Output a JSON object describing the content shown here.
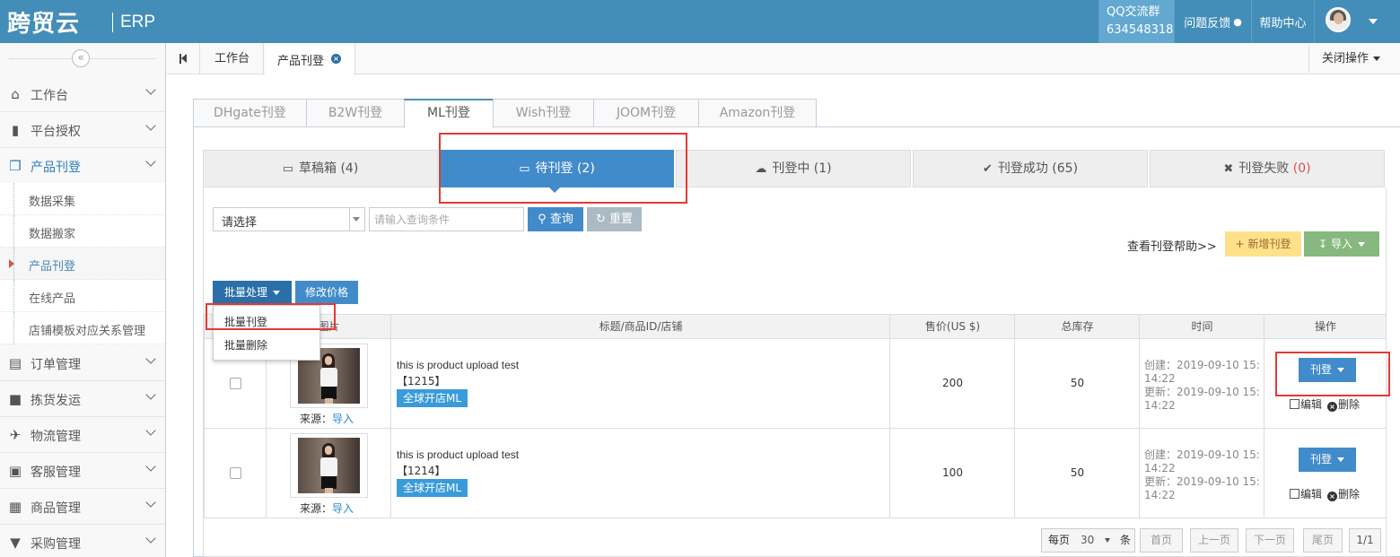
{
  "header": {
    "logo_text": "跨贸云",
    "logo_sub": "ERP",
    "qq_label": "QQ交流群",
    "qq_number": "634548318",
    "feedback": "问题反馈",
    "help": "帮助中心"
  },
  "sidebar": {
    "collapse": "«",
    "items": [
      {
        "label": "工作台",
        "icon": "home-icon"
      },
      {
        "label": "平台授权",
        "icon": "bookmark-icon"
      },
      {
        "label": "产品刊登",
        "icon": "cube-icon"
      },
      {
        "label": "订单管理",
        "icon": "document-icon"
      },
      {
        "label": "拣货发运",
        "icon": "truck-icon"
      },
      {
        "label": "物流管理",
        "icon": "plane-icon"
      },
      {
        "label": "客服管理",
        "icon": "briefcase-icon"
      },
      {
        "label": "商品管理",
        "icon": "gift-icon"
      },
      {
        "label": "采购管理",
        "icon": "cart-icon"
      }
    ],
    "subitems": [
      "数据采集",
      "数据搬家",
      "产品刊登",
      "在线产品",
      "店铺模板对应关系管理"
    ]
  },
  "tabs": {
    "work": "工作台",
    "current": "产品刊登",
    "close_ops": "关闭操作"
  },
  "platform_tabs": [
    "DHgate刊登",
    "B2W刊登",
    "ML刊登",
    "Wish刊登",
    "JOOM刊登",
    "Amazon刊登"
  ],
  "status_tabs": [
    {
      "label": "草稿箱",
      "count": "(4)"
    },
    {
      "label": "待刊登",
      "count": "(2)"
    },
    {
      "label": "刊登中",
      "count": "(1)"
    },
    {
      "label": "刊登成功",
      "count": "(65)"
    },
    {
      "label": "刊登失败",
      "count": "(0)"
    }
  ],
  "search": {
    "select_placeholder": "请选择",
    "input_placeholder": "请输入查询条件",
    "query": "查询",
    "reset": "重置"
  },
  "actions": {
    "help_link": "查看刊登帮助>>",
    "new": "新增刊登",
    "import": "导入",
    "batch": "批量处理",
    "modify_price": "修改价格",
    "batch_publish": "批量刊登",
    "batch_delete": "批量删除"
  },
  "table": {
    "headers": [
      "",
      "图片",
      "标题/商品ID/店铺",
      "售价(US $)",
      "总库存",
      "时间",
      "操作"
    ],
    "rows": [
      {
        "title": "this is product upload test",
        "id": "【1215】",
        "store": "全球开店ML",
        "source_label": "来源：",
        "source_value": "导入",
        "price": "200",
        "stock": "50",
        "created": "创建：2019-09-10 15:14:22",
        "updated": "更新：2019-09-10 15:14:22",
        "publish": "刊登",
        "edit": "编辑",
        "delete": "删除"
      },
      {
        "title": "this is product upload test",
        "id": "【1214】",
        "store": "全球开店ML",
        "source_label": "来源：",
        "source_value": "导入",
        "price": "100",
        "stock": "50",
        "created": "创建：2019-09-10 15:14:22",
        "updated": "更新：2019-09-10 15:14:22",
        "publish": "刊登",
        "edit": "编辑",
        "delete": "删除"
      }
    ]
  },
  "pager": {
    "per_page_label": "每页",
    "per_page": "30",
    "unit": "条",
    "first": "首页",
    "prev": "上一页",
    "next": "下一页",
    "last": "尾页",
    "page": "1/1"
  },
  "colors": {
    "header_bg": "#438eb9",
    "primary": "#428bca",
    "highlight": "#e53935",
    "fail": "#d9534f"
  }
}
